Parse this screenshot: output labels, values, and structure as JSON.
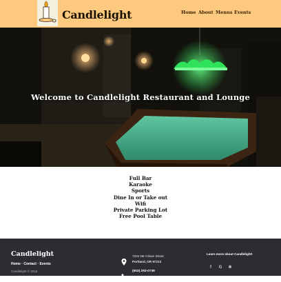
{
  "header": {
    "logo_text": "Candlelight",
    "nav": [
      "Home",
      "About",
      "Menus",
      "Events"
    ]
  },
  "hero": {
    "title": "Welcome to Candlelight Restaurant and Lounge"
  },
  "features": [
    "Full Bar",
    "Karaoke",
    "Sports",
    "Dine In or Take out",
    "Wifi",
    "Private Parking Lot",
    "Free Pool Table"
  ],
  "footer": {
    "brand": "Candlelight",
    "links": [
      "Home",
      "Contact",
      "Events"
    ],
    "separator": "·",
    "copyright": "Candlelight © 2016",
    "address_line1": "7204 NE Glisan Street",
    "address_line2": "Portland, OR 97213",
    "phone": "(503) 253-0738",
    "learn_more": "Learn more about Candlelight!",
    "social": [
      {
        "icon": "facebook-icon",
        "glyph": "f"
      },
      {
        "icon": "google-icon",
        "glyph": "G"
      },
      {
        "icon": "yelp-icon",
        "glyph": "✻"
      }
    ]
  },
  "colors": {
    "header_bg": "#fcc97e",
    "footer_bg": "#2c2d30",
    "lamp_green": "#2ee35a",
    "felt": "#3fa384"
  }
}
